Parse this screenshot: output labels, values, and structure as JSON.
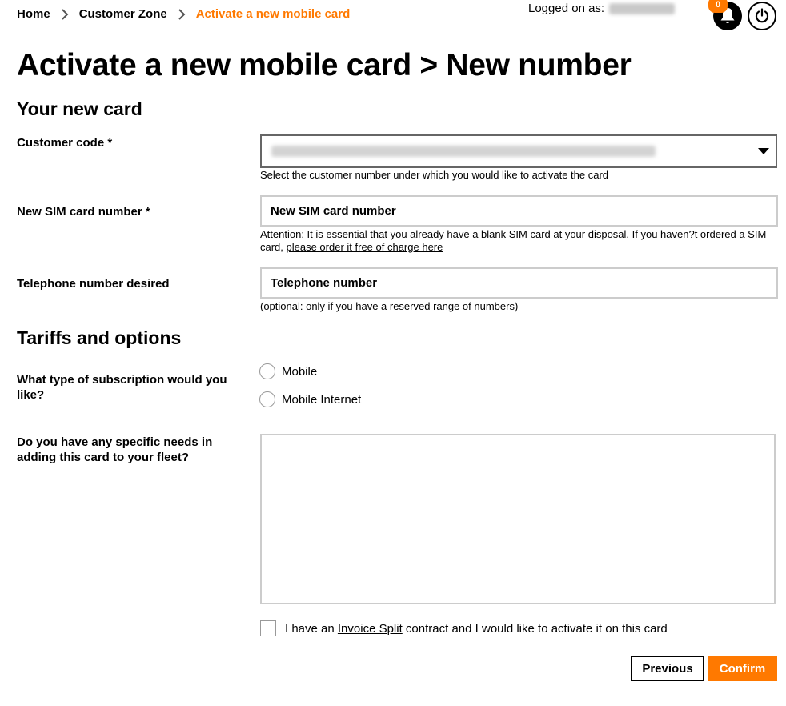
{
  "breadcrumb": {
    "home": "Home",
    "customer_zone": "Customer Zone",
    "current": "Activate a new mobile card"
  },
  "header": {
    "logged_on_label": "Logged on as:",
    "notification_count": "0",
    "icons": [
      "bell-icon",
      "power-icon",
      "chevron-right-icon",
      "caret-down-icon"
    ]
  },
  "page": {
    "title": "Activate a new mobile card > New number"
  },
  "card_section": {
    "title": "Your new card",
    "customer_code": {
      "label": "Customer code *",
      "help": "Select the customer number under which you would like to activate the card"
    },
    "sim_card": {
      "label": "New SIM card number *",
      "placeholder": "New SIM card number",
      "help_prefix": "Attention: It is essential that you already have a blank SIM card at your disposal. If you haven?t ordered a SIM card, ",
      "help_link": "please order it free of charge here"
    },
    "telephone": {
      "label": "Telephone number desired",
      "placeholder": "Telephone number",
      "help": "(optional: only if you have a reserved range of numbers)"
    }
  },
  "tariffs_section": {
    "title": "Tariffs and options",
    "subscription_question": "What type of subscription would you like?",
    "options": [
      "Mobile",
      "Mobile Internet"
    ],
    "needs_question": "Do you have any specific needs in adding this card to your fleet?",
    "invoice_prefix": "I have an ",
    "invoice_link": "Invoice Split",
    "invoice_suffix": " contract and I would like to activate it on this card"
  },
  "actions": {
    "previous": "Previous",
    "confirm": "Confirm"
  },
  "colors": {
    "accent": "#ff7900",
    "text": "#000000",
    "border": "#cccccc"
  }
}
